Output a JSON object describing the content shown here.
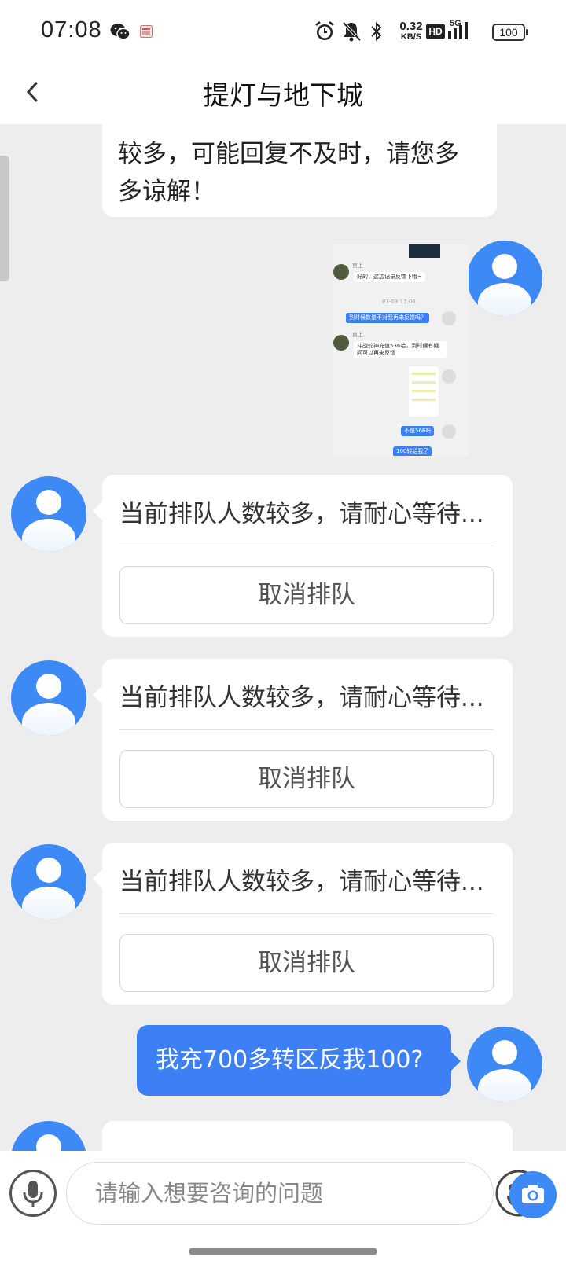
{
  "status_bar": {
    "time": "07:08",
    "net_speed_value": "0.32",
    "net_speed_unit": "KB/S",
    "hd_badge": "HD",
    "network": "5G",
    "battery": "100",
    "icons": [
      "wechat-icon",
      "app-notification-icon",
      "alarm-icon",
      "mute-icon",
      "bluetooth-icon",
      "hd-icon",
      "signal-icon",
      "battery-icon"
    ]
  },
  "header": {
    "title": "提灯与地下城",
    "back_icon": "chevron-left-icon"
  },
  "messages": {
    "agent_notice": {
      "line1": "较多，可能回复不及时，请您多",
      "line2": "多谅解！"
    },
    "thumbnail": {
      "sender_label": "官上",
      "reply1": "好的，这边记录反馈下哦~",
      "timestamp": "03-03 17:06",
      "user1": "到时候数量不对我再来反馈吗？",
      "reply2": "斗战蛇神充值536哈，到时候有疑问可以再来反馈",
      "user2": "不是566吗",
      "user3": "100转给我了"
    },
    "queue_items": [
      {
        "text": "当前排队人数较多，请耐心等待...",
        "cancel_label": "取消排队"
      },
      {
        "text": "当前排队人数较多，请耐心等待...",
        "cancel_label": "取消排队"
      },
      {
        "text": "当前排队人数较多，请耐心等待...",
        "cancel_label": "取消排队"
      }
    ],
    "user_message": "我充700多转区反我100?"
  },
  "input": {
    "placeholder": "请输入想要咨询的问题",
    "value": ""
  },
  "colors": {
    "accent": "#3d8af7",
    "user_bubble": "#3d7ff5",
    "background": "#ededed"
  }
}
